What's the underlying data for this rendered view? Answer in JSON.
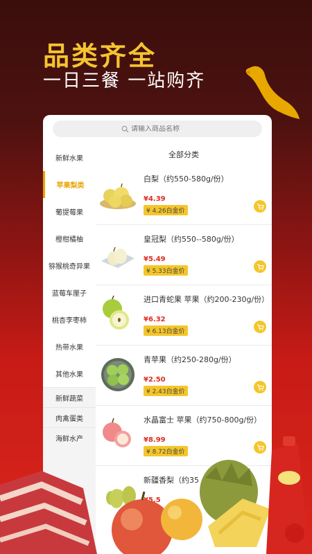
{
  "promo": {
    "headline": "品类齐全",
    "subline": "一日三餐 一站购齐"
  },
  "search": {
    "placeholder": "请输入商品名称"
  },
  "sidebar": {
    "categories": [
      {
        "label": "新鲜水果"
      },
      {
        "label": "苹果梨类",
        "active": true
      },
      {
        "label": "葡提莓果"
      },
      {
        "label": "橙柑橘柚"
      },
      {
        "label": "猕猴桃奇异果"
      },
      {
        "label": "蓝莓车厘子"
      },
      {
        "label": "桃杏李枣柿"
      },
      {
        "label": "热带水果"
      },
      {
        "label": "其他水果"
      },
      {
        "label": "新鲜蔬菜"
      },
      {
        "label": "肉禽蛋类"
      },
      {
        "label": "海鲜水产"
      }
    ]
  },
  "main": {
    "title": "全部分类",
    "products": [
      {
        "name": "白梨（约550-580g/份）",
        "price": "¥4.39",
        "member_price": "¥ 4.26白金价",
        "icon": "pear-icon"
      },
      {
        "name": "皇冠梨（约550--580g/份）",
        "price": "¥5.49",
        "member_price": "¥ 5.33白金价",
        "icon": "crown-pear-icon"
      },
      {
        "name": "进口青蛇果 苹果（约200-230g/份）",
        "price": "¥6.32",
        "member_price": "¥ 6.13白金价",
        "icon": "green-apple-icon"
      },
      {
        "name": "青苹果（约250-280g/份）",
        "price": "¥2.50",
        "member_price": "¥ 2.43白金价",
        "icon": "green-apple-plate-icon"
      },
      {
        "name": "水晶富士 苹果（约750-800g/份）",
        "price": "¥8.99",
        "member_price": "¥ 8.72白金价",
        "icon": "red-apple-icon"
      },
      {
        "name": "新疆香梨（约35",
        "price": "¥5.5",
        "member_price": "",
        "icon": "fragrant-pear-icon"
      }
    ]
  },
  "colors": {
    "accent": "#f5c62a",
    "price": "#e02b20",
    "headline": "#f5c430"
  }
}
